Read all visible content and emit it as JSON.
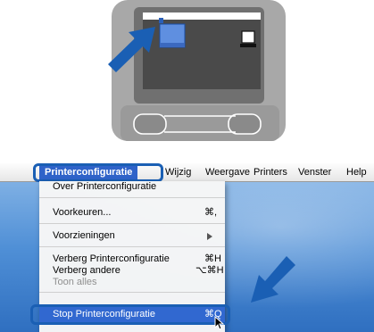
{
  "menubar": {
    "app_menu": "Printerconfiguratie",
    "items": [
      "Wijzig",
      "Weergave",
      "Printers",
      "Venster",
      "Help"
    ]
  },
  "menu": {
    "items": [
      {
        "label": "Over Printerconfiguratie",
        "shortcut": ""
      },
      {
        "label": "Voorkeuren...",
        "shortcut": "⌘,"
      },
      {
        "label": "Voorzieningen",
        "shortcut": ""
      },
      {
        "label": "Verberg Printerconfiguratie",
        "shortcut": "⌘H"
      },
      {
        "label": "Verberg andere",
        "shortcut": "⌥⌘H"
      },
      {
        "label": "Toon alles",
        "shortcut": ""
      },
      {
        "label": "Stop Printerconfiguratie",
        "shortcut": "⌘Q"
      }
    ]
  },
  "colors": {
    "highlight": "#1a5fb4",
    "selection": "#3168d0"
  }
}
